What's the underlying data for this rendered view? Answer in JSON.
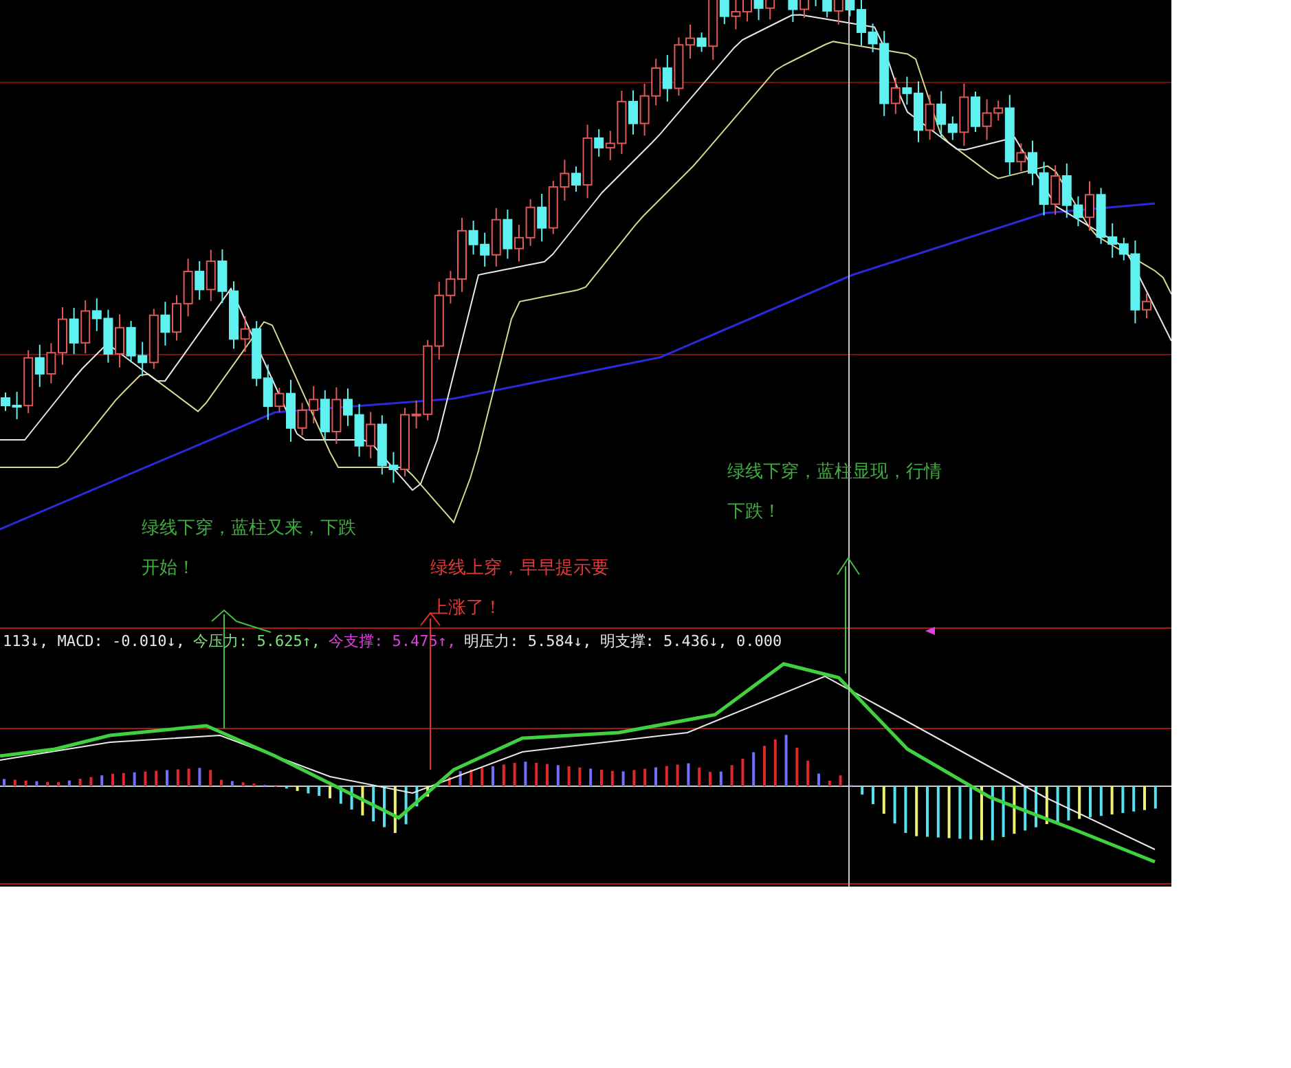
{
  "annotations": [
    {
      "lines": [
        "绿线下穿，蓝柱又来，下跌",
        "开始！"
      ],
      "color": "#3fae3f"
    },
    {
      "lines": [
        "绿线上穿，早早提示要",
        "上涨了！"
      ],
      "color": "#e03a3a"
    },
    {
      "lines": [
        "绿线下穿，蓝柱显现，行情",
        "下跌！"
      ],
      "color": "#3fae3f"
    }
  ],
  "readout": [
    {
      "text": "113↓, MACD: -0.010↓,",
      "color": "#e8e8e8"
    },
    {
      "text": "今压力: 5.625↑,",
      "color": "#7fe07f"
    },
    {
      "text": "今支撑: 5.475↑,",
      "color": "#e040e0"
    },
    {
      "text": "明压力: 5.584↓,",
      "color": "#e8e8e8"
    },
    {
      "text": "明支撑: 5.436↓, 0.000",
      "color": "#e8e8e8"
    }
  ]
}
